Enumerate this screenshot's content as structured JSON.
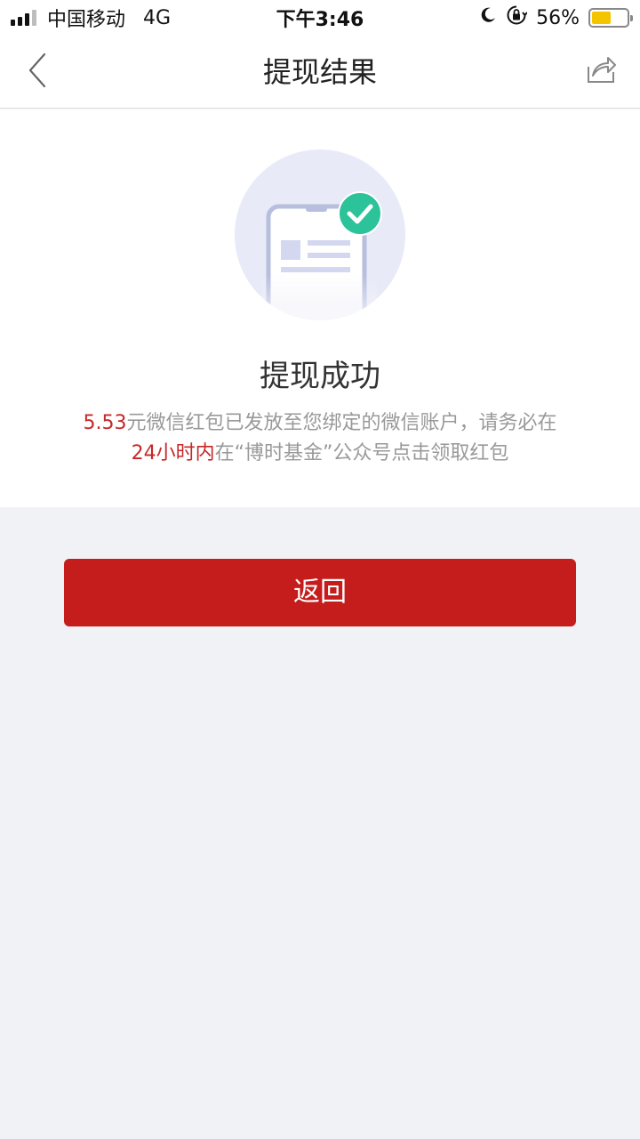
{
  "status_bar": {
    "carrier": "中国移动",
    "network": "4G",
    "time": "下午3:46",
    "battery_percent": "56%",
    "battery_level": 0.56,
    "icons": [
      "signal-icon",
      "moon-icon",
      "orientation-lock-icon",
      "battery-icon"
    ]
  },
  "nav": {
    "title": "提现结果",
    "back_icon": "chevron-left-icon",
    "share_icon": "share-icon"
  },
  "result": {
    "illustration": "phone-success-illustration",
    "title": "提现成功",
    "desc": {
      "amount": "5.53",
      "part1": "元微信红包已发放至您绑定的微信账户，请务必在",
      "deadline": "24小时内",
      "part2": "在“博时基金”公众号点击领取红包"
    }
  },
  "actions": {
    "return_label": "返回"
  },
  "colors": {
    "accent": "#c41d1c",
    "highlight": "#c62828",
    "success": "#2cc29a",
    "page_bg": "#f1f2f6"
  }
}
